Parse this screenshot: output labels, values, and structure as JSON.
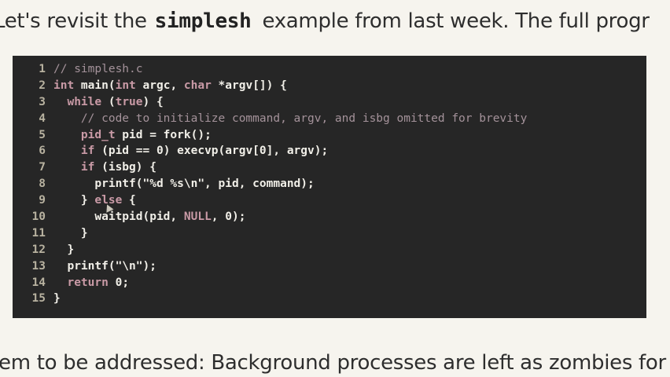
{
  "slide": {
    "intro_before": "Let's revisit the ",
    "intro_code": "simplesh",
    "intro_after": " example from last week. The full progr",
    "bottom_text": "em to be addressed: Background processes are left as zombies for"
  },
  "code": {
    "lines": [
      {
        "n": "1",
        "tokens": [
          {
            "t": "// simplesh.c",
            "c": "cm"
          }
        ]
      },
      {
        "n": "2",
        "tokens": [
          {
            "t": "int",
            "c": "kw"
          },
          {
            "t": " main(",
            "c": "plain"
          },
          {
            "t": "int",
            "c": "kw"
          },
          {
            "t": " argc, ",
            "c": "plain"
          },
          {
            "t": "char",
            "c": "kw"
          },
          {
            "t": " *argv[]) {",
            "c": "plain"
          }
        ]
      },
      {
        "n": "3",
        "tokens": [
          {
            "t": "  ",
            "c": "plain"
          },
          {
            "t": "while",
            "c": "kw"
          },
          {
            "t": " (",
            "c": "plain"
          },
          {
            "t": "true",
            "c": "kw"
          },
          {
            "t": ") {",
            "c": "plain"
          }
        ]
      },
      {
        "n": "4",
        "tokens": [
          {
            "t": "    ",
            "c": "plain"
          },
          {
            "t": "// code to initialize command, argv, and isbg omitted for brevity",
            "c": "cm"
          }
        ]
      },
      {
        "n": "5",
        "tokens": [
          {
            "t": "    ",
            "c": "plain"
          },
          {
            "t": "pid_t",
            "c": "kw"
          },
          {
            "t": " pid = fork();",
            "c": "plain"
          }
        ]
      },
      {
        "n": "6",
        "tokens": [
          {
            "t": "    ",
            "c": "plain"
          },
          {
            "t": "if",
            "c": "kw"
          },
          {
            "t": " (pid == 0) execvp(argv[0], argv);",
            "c": "plain"
          }
        ]
      },
      {
        "n": "7",
        "tokens": [
          {
            "t": "    ",
            "c": "plain"
          },
          {
            "t": "if",
            "c": "kw"
          },
          {
            "t": " (isbg) {",
            "c": "plain"
          }
        ]
      },
      {
        "n": "8",
        "tokens": [
          {
            "t": "      printf(\"",
            "c": "plain"
          },
          {
            "t": "%d %s\\n",
            "c": "str"
          },
          {
            "t": "\", pid, command);",
            "c": "plain"
          }
        ]
      },
      {
        "n": "9",
        "tokens": [
          {
            "t": "    } ",
            "c": "plain"
          },
          {
            "t": "else",
            "c": "kw"
          },
          {
            "t": " {",
            "c": "plain"
          }
        ]
      },
      {
        "n": "10",
        "tokens": [
          {
            "t": "      waitpid(pid, ",
            "c": "plain"
          },
          {
            "t": "NULL",
            "c": "kw"
          },
          {
            "t": ", 0);",
            "c": "plain"
          }
        ]
      },
      {
        "n": "11",
        "tokens": [
          {
            "t": "    }",
            "c": "plain"
          }
        ]
      },
      {
        "n": "12",
        "tokens": [
          {
            "t": "  }",
            "c": "plain"
          }
        ]
      },
      {
        "n": "13",
        "tokens": [
          {
            "t": "  printf(\"\\n\");",
            "c": "plain"
          }
        ]
      },
      {
        "n": "14",
        "tokens": [
          {
            "t": "  ",
            "c": "plain"
          },
          {
            "t": "return",
            "c": "kw"
          },
          {
            "t": " 0;",
            "c": "plain"
          }
        ]
      },
      {
        "n": "15",
        "tokens": [
          {
            "t": "}",
            "c": "plain"
          }
        ]
      }
    ]
  },
  "colors": {
    "page_background": "#f6f4ee",
    "code_background": "#262626",
    "keyword": "#c99aa6",
    "comment": "#a4929a",
    "plain": "#f1efe8",
    "line_number": "#b8b2a0"
  },
  "icons": {
    "cursor": "mouse-cursor-icon"
  }
}
